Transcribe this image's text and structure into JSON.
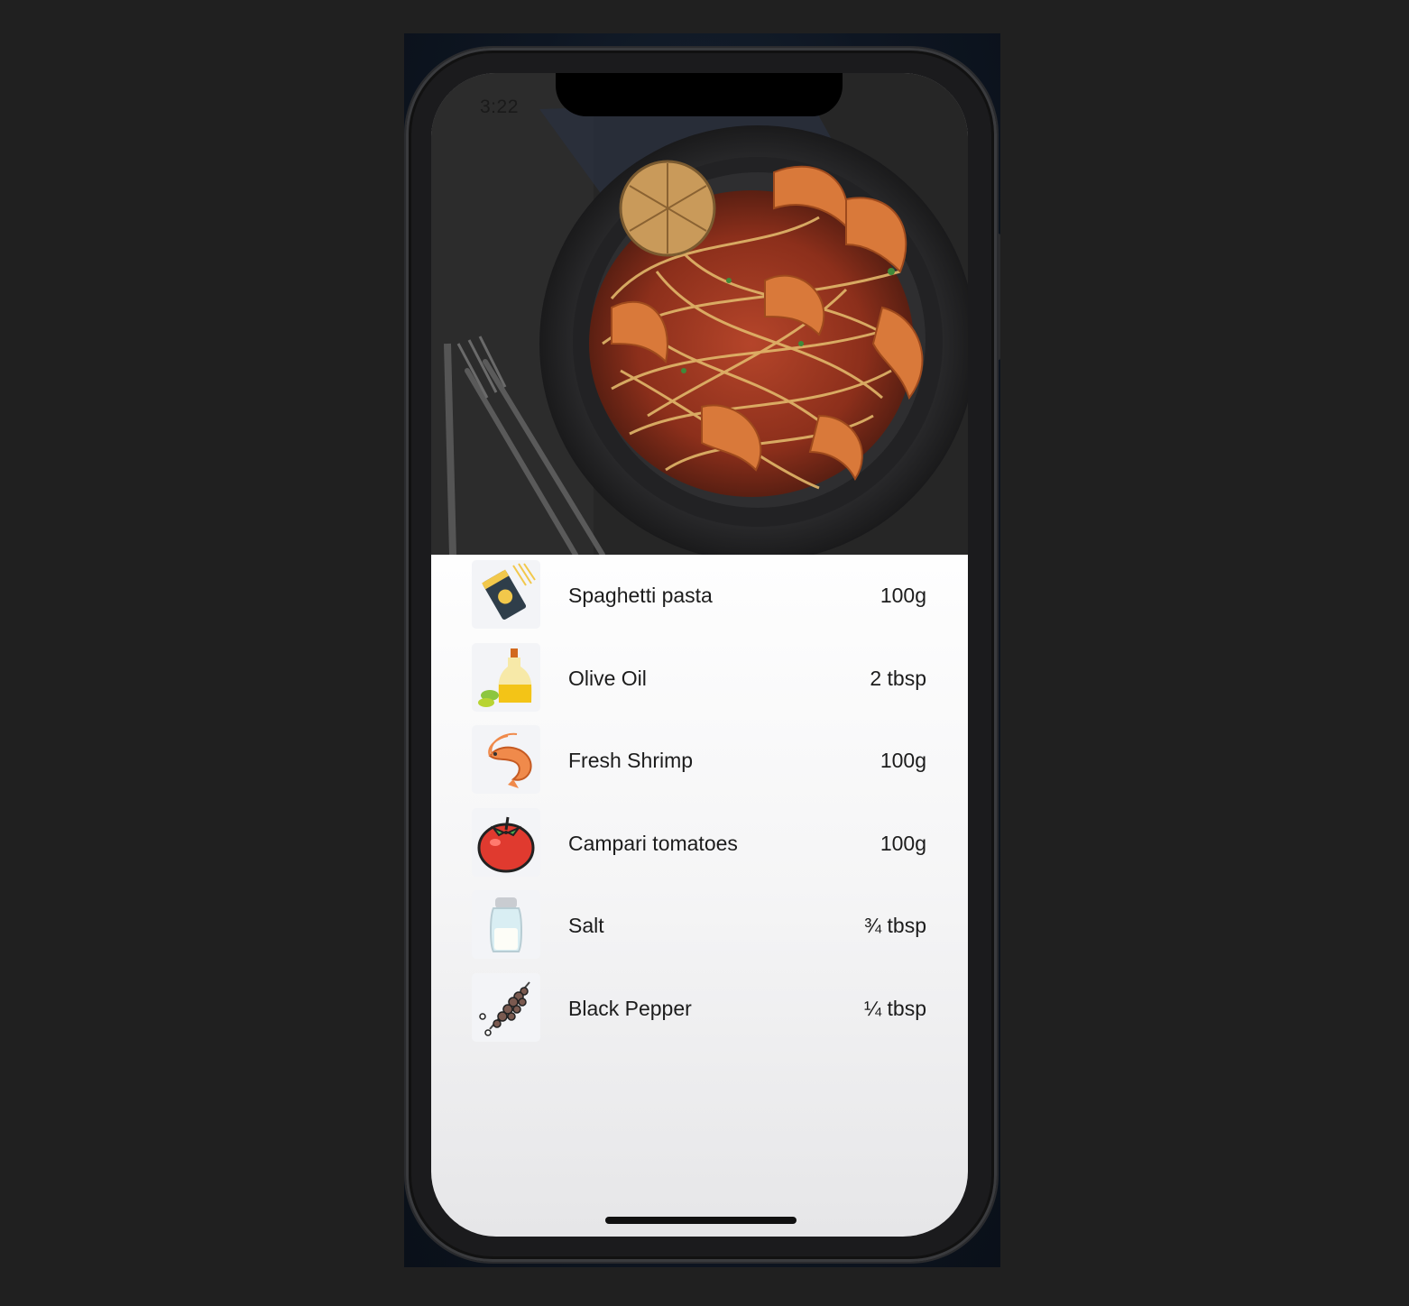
{
  "status_bar": {
    "time": "3:22"
  },
  "hero": {
    "image_icon": "shrimp-spaghetti-plate-photo"
  },
  "ingredients": [
    {
      "name": "Spaghetti pasta",
      "quantity": "100g",
      "icon": "pasta-package-icon"
    },
    {
      "name": "Olive Oil",
      "quantity": "2 tbsp",
      "icon": "olive-oil-bottle-icon"
    },
    {
      "name": "Fresh Shrimp",
      "quantity": "100g",
      "icon": "shrimp-icon"
    },
    {
      "name": "Campari tomatoes",
      "quantity": "100g",
      "icon": "tomato-icon"
    },
    {
      "name": "Salt",
      "quantity": "¾ tbsp",
      "icon": "salt-shaker-icon"
    },
    {
      "name": "Black Pepper",
      "quantity": "¼ tbsp",
      "icon": "black-pepper-icon"
    }
  ],
  "colors": {
    "page_bg": "#202020",
    "phone_frame": "#1b1b1d",
    "text": "#1c1c1c",
    "thumb_bg": "#f3f4f7"
  }
}
